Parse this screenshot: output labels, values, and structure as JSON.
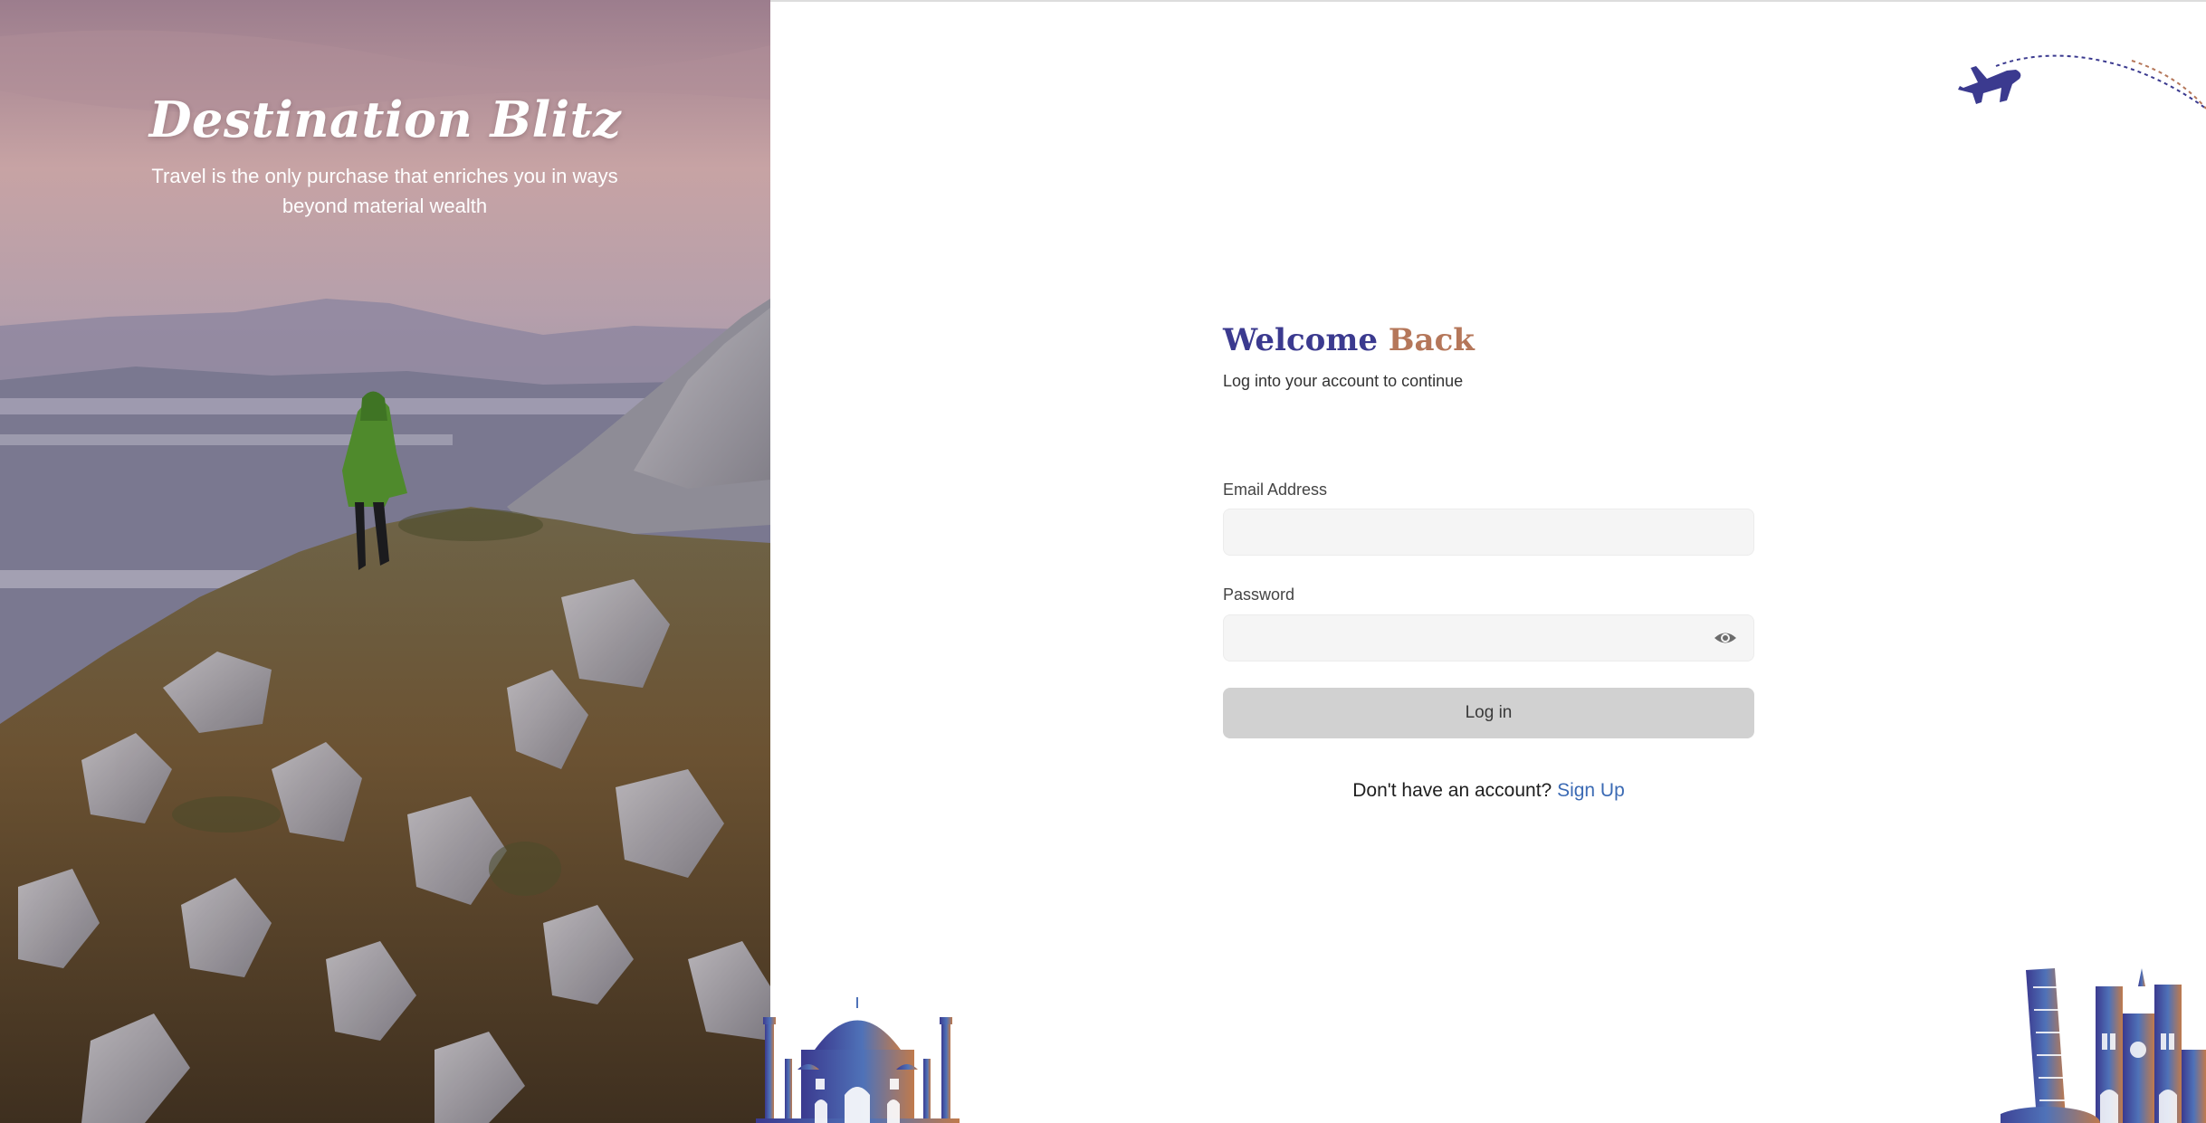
{
  "hero": {
    "title": "Destination Blitz",
    "tagline": "Travel is the only purchase that enriches you in ways beyond material wealth",
    "image": "hiker-on-mountain-ridge"
  },
  "login": {
    "heading_part1": "Welcome",
    "heading_part2": "Back",
    "subtitle": "Log into your account to continue",
    "email": {
      "label": "Email Address",
      "value": "",
      "placeholder": ""
    },
    "password": {
      "label": "Password",
      "value": "",
      "placeholder": ""
    },
    "submit_label": "Log in",
    "signup_prompt": "Don't have an account?",
    "signup_link": "Sign Up"
  },
  "icons": {
    "password_toggle": "eye-icon",
    "decor_top": "airplane-icon",
    "decor_bottom_left": "taj-mahal-illustration",
    "decor_bottom_right": "landmarks-illustration"
  },
  "colors": {
    "heading_blue": "#3b3a8f",
    "heading_copper": "#b5775a",
    "link": "#3b6ab4",
    "button_bg": "#d1d1d1",
    "input_bg": "#f5f5f5"
  }
}
